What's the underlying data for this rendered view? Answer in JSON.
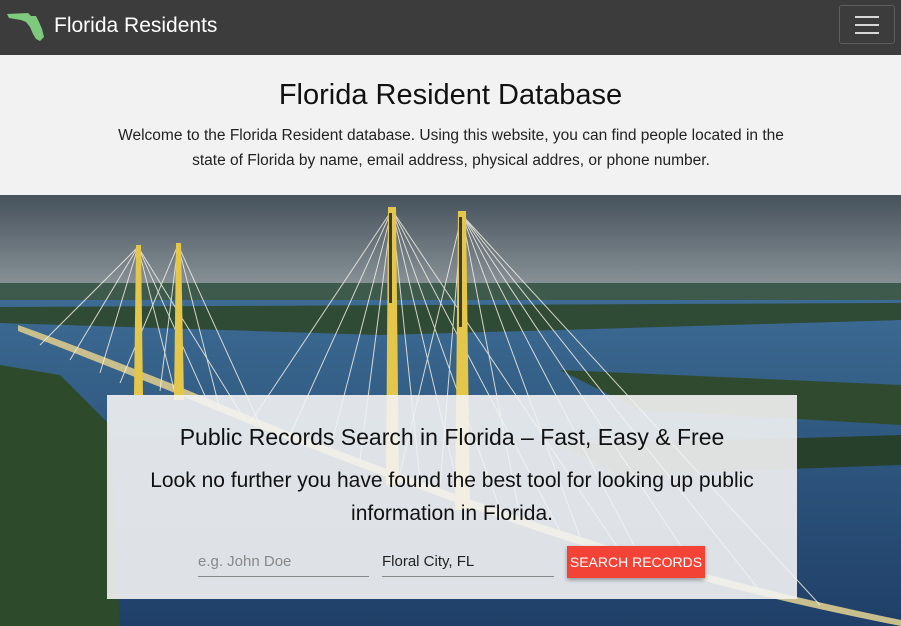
{
  "navbar": {
    "brand_text": "Florida Residents",
    "logo_icon": "florida-state-shape-icon",
    "menu_icon": "hamburger-menu-icon",
    "logo_color": "#7fc97f",
    "background": "#3c3c3c"
  },
  "intro": {
    "title": "Florida Resident Database",
    "description": "Welcome to the Florida Resident database. Using this website, you can find people located in the state of Florida by name, email address, physical addres, or phone number."
  },
  "search_card": {
    "title": "Public Records Search in Florida – Fast, Easy & Free",
    "subtitle": "Look no further you have found the best tool for looking up public information in Florida.",
    "name_placeholder": "e.g. John Doe",
    "location_value": "Floral City, FL",
    "button_label": "SEARCH RECORDS",
    "button_color": "#f34336"
  }
}
